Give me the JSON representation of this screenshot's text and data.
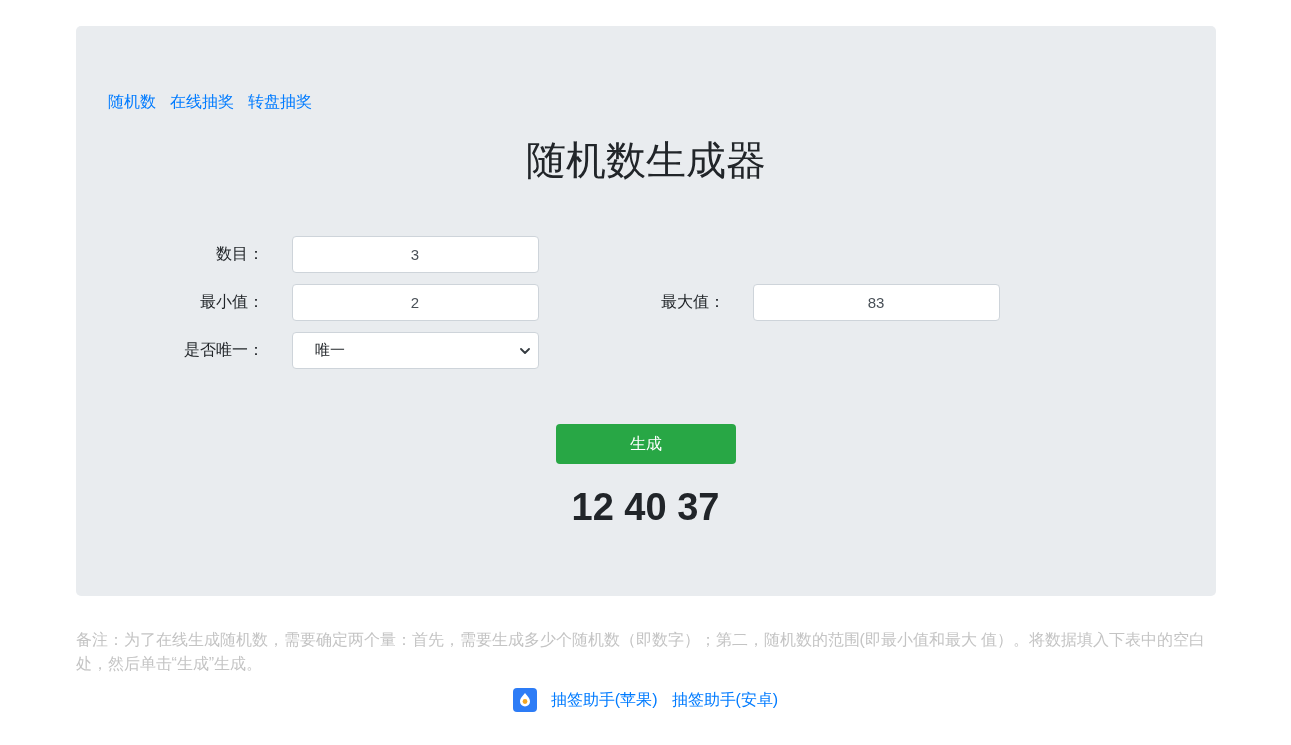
{
  "nav_links": [
    "随机数",
    "在线抽奖",
    "转盘抽奖"
  ],
  "title": "随机数生成器",
  "form": {
    "rows": [
      [
        {
          "kind": "input",
          "label": "数目：",
          "value": "3"
        }
      ],
      [
        {
          "kind": "input",
          "label": "最小值：",
          "value": "2"
        },
        {
          "kind": "input",
          "label": "最大值：",
          "value": "83"
        }
      ],
      [
        {
          "kind": "select",
          "label": "是否唯一：",
          "value": "唯一"
        }
      ]
    ]
  },
  "generate_button": "生成",
  "result": "12 40 37",
  "note": "备注：为了在线生成随机数，需要确定两个量：首先，需要生成多少个随机数（即数字）；第二，随机数的范围(即最小值和最大 值）。将数据填入下表中的空白处，然后单击“生成”生成。",
  "app_links": [
    "抽签助手(苹果)",
    "抽签助手(安卓)"
  ]
}
